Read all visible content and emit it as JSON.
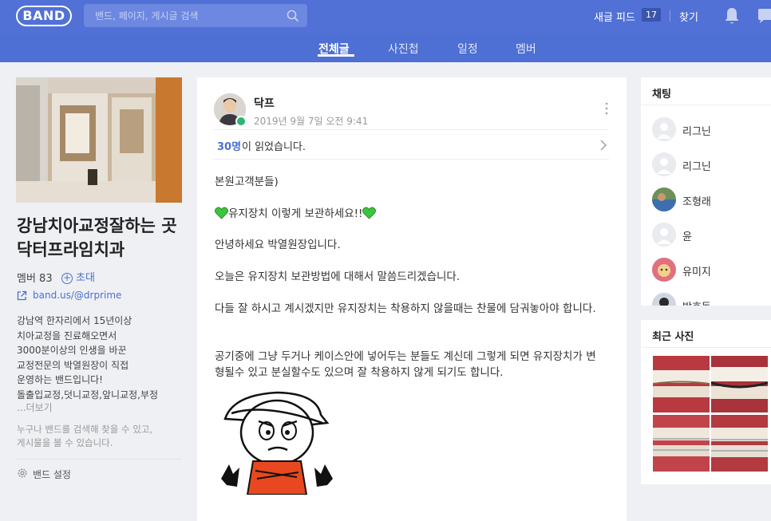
{
  "header": {
    "logo": "BAND",
    "search_placeholder": "밴드, 페이지, 게시글 검색",
    "new_feed_label": "새글 피드",
    "new_feed_count": "17",
    "find_label": "찾기"
  },
  "tabs": [
    {
      "label": "전체글",
      "active": true
    },
    {
      "label": "사진첩",
      "active": false
    },
    {
      "label": "일정",
      "active": false
    },
    {
      "label": "멤버",
      "active": false
    }
  ],
  "band": {
    "title": "강남치아교정잘하는 곳 닥터프라임치과",
    "members_label": "멤버 83",
    "invite_label": "초대",
    "link": "band.us/@drprime",
    "description": "강남역 한자리에서 15년이상\n치아교정을 진료해오면서\n3000분이상의 인생을 바꾼\n교정전문의 박열원장이 직접\n운영하는 밴드입니다!\n돌출입교정,덧니교정,앞니교정,부정",
    "more_label": "...더보기",
    "notice": "누구나 밴드를 검색해 찾을 수 있고,\n게시물을 볼 수 있습니다.",
    "settings_label": "밴드 설정"
  },
  "post": {
    "author": "닥프",
    "date": "2019년 9월 7일 오전 9:41",
    "read_count": "30명",
    "read_text": "이 읽었습니다.",
    "lines": {
      "greeting": "본원고객분들)",
      "headline": "유지장치 이렇게 보관하세요!!",
      "intro": "안녕하세요 박열원장입니다.",
      "topic": "오늘은 유지장치 보관방법에 대해서 말씀드리겠습니다.",
      "body1": "다들 잘 하시고 계시겠지만 유지장치는 착용하지 않을때는 찬물에 담궈놓아야 합니다.",
      "body2": "공기중에 그냥 두거나 케이스안에 넣어두는 분들도 계신데 그렇게 되면 유지장치가 변형될수 있고 분실할수도 있으며 잘 착용하지 않게 되기도 합니다."
    }
  },
  "chat": {
    "title": "채팅",
    "items": [
      {
        "name": "리그닌"
      },
      {
        "name": "리그닌"
      },
      {
        "name": "조형래"
      },
      {
        "name": "윤"
      },
      {
        "name": "유미지"
      },
      {
        "name": "박효동"
      }
    ]
  },
  "photos": {
    "title": "최근 사진"
  },
  "colors": {
    "brand": "#5271d6",
    "heart": "#3cc43c",
    "link": "#4e6fd3"
  }
}
